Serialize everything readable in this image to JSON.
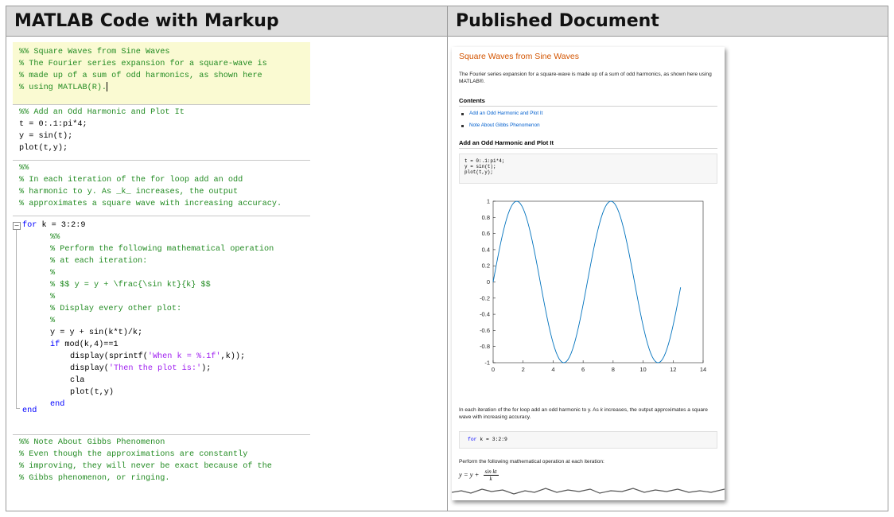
{
  "headers": {
    "left": "MATLAB Code with Markup",
    "right": "Published Document"
  },
  "editor": {
    "cell1": [
      "%% Square Waves from Sine Waves",
      "% The Fourier series expansion for a square-wave is",
      "% made up of a sum of odd harmonics, as shown here",
      "% using MATLAB(R)."
    ],
    "cell2": {
      "heading": "%% Add an Odd Harmonic and Plot It",
      "code": [
        "t = 0:.1:pi*4;",
        "y = sin(t);",
        "plot(t,y);"
      ]
    },
    "cell3": [
      "%%",
      "% In each iteration of the for loop add an odd",
      "% harmonic to y. As _k_ increases, the output",
      "% approximates a square wave with increasing accuracy."
    ],
    "loop": {
      "for_kw": "for",
      "for_rest": " k = 3:2:9",
      "comments": [
        "%%",
        "% Perform the following mathematical operation",
        "% at each iteration:",
        "%",
        "% $$ y = y + \\frac{\\sin kt}{k} $$",
        "%",
        "% Display every other plot:",
        "%"
      ],
      "assign": "y = y + sin(k*t)/k;",
      "if_kw": "if",
      "if_rest": " mod(k,4)==1",
      "disp1_pre": "display(sprintf(",
      "disp1_str": "'When k = %.1f'",
      "disp1_post": ",k));",
      "disp2_pre": "display(",
      "disp2_str": "'Then the plot is:'",
      "disp2_post": ");",
      "cla": "cla",
      "plot": "plot(t,y)",
      "end_inner": "end",
      "end_outer": "end"
    },
    "cell4": [
      "%% Note About Gibbs Phenomenon",
      "% Even though the approximations are constantly",
      "% improving, they will never be exact because of the",
      "% Gibbs phenomenon, or ringing."
    ]
  },
  "published": {
    "title": "Square Waves from Sine Waves",
    "intro": "The Fourier series expansion for a square-wave is made up of a sum of odd harmonics, as shown here using MATLAB®.",
    "contents_heading": "Contents",
    "contents": [
      "Add an Odd Harmonic and Plot It",
      "Note About Gibbs Phenomenon"
    ],
    "section1": "Add an Odd Harmonic and Plot It",
    "code1": [
      "t = 0:.1:pi*4;",
      "y = sin(t);",
      "plot(t,y);"
    ],
    "para2_pre": "In each iteration of the for loop add an odd harmonic to y. As ",
    "para2_k": "k",
    "para2_post": " increases, the output approximates a square wave with increasing accuracy.",
    "code2_kw": "for",
    "code2_rest": " k = 3:2:9",
    "para3": "Perform the following mathematical operation at each iteration:",
    "eq_lhs": "y = y + ",
    "eq_num": "sin kt",
    "eq_den": "k"
  },
  "chart_data": {
    "type": "line",
    "x_step": 0.1,
    "x_range": [
      0,
      12.5
    ],
    "function": "y = sin(x)",
    "xlim": [
      0,
      14
    ],
    "ylim": [
      -1,
      1
    ],
    "xticks": [
      "0",
      "2",
      "4",
      "6",
      "8",
      "10",
      "12",
      "14"
    ],
    "yticks": [
      "1",
      "0.8",
      "0.6",
      "0.4",
      "0.2",
      "0",
      "-0.2",
      "-0.4",
      "-0.6",
      "-0.8",
      "-1"
    ],
    "line_color": "#0072bd",
    "grid": false
  }
}
